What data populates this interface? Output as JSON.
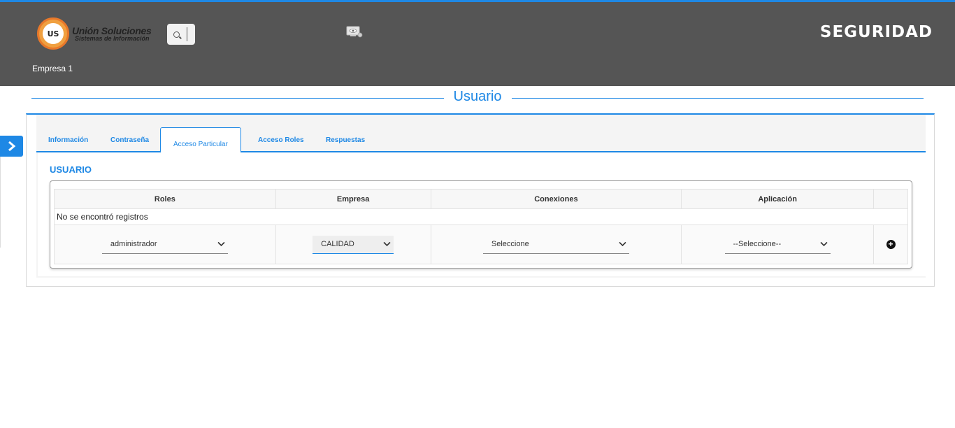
{
  "header": {
    "logo_badge": "US",
    "logo_title": "Unión Soluciones",
    "logo_subtitle": "Sistemas de Información",
    "brand": "SEGURIDAD",
    "company": "Empresa 1",
    "icons": [
      "search-icon",
      "monitor-eye-icon"
    ]
  },
  "page": {
    "title": "Usuario"
  },
  "tabs": [
    {
      "label": "Información"
    },
    {
      "label": "Contraseña"
    },
    {
      "label": "Acceso Particular",
      "active": true
    },
    {
      "label": "Acceso Roles"
    },
    {
      "label": "Respuestas"
    }
  ],
  "section": {
    "title": "USUARIO"
  },
  "table": {
    "headers": [
      "Roles",
      "Empresa",
      "Conexiones",
      "Aplicación",
      ""
    ],
    "empty_message": "No se encontró registros",
    "row": {
      "roles": "administrador",
      "empresa": "CALIDAD",
      "conexiones": "Seleccione",
      "aplicacion": "--Seleccione--"
    }
  },
  "colors": {
    "accent": "#1e88e5",
    "header_bg": "#555555"
  }
}
